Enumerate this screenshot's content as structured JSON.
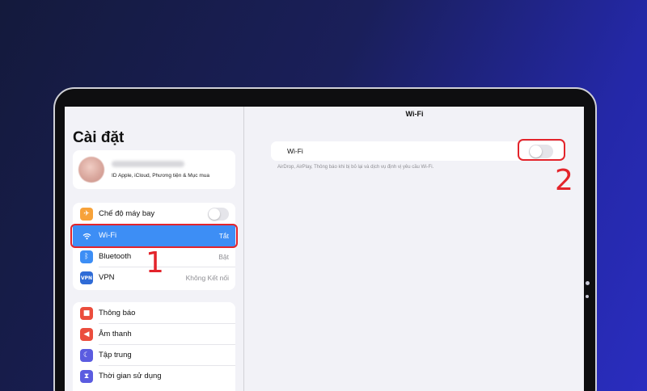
{
  "settings": {
    "title": "Cài đặt",
    "profile": {
      "subtitle": "ID Apple, iCloud, Phương tiện & Mục mua"
    },
    "group1": [
      {
        "label": "Chế độ máy bay",
        "value": "",
        "icon_color": "#f7a23a",
        "icon": "airplane-icon",
        "glyph": "✈"
      },
      {
        "label": "Wi-Fi",
        "value": "Tắt",
        "icon_color": "#3d8ef5",
        "icon": "wifi-icon",
        "glyph": "◠"
      },
      {
        "label": "Bluetooth",
        "value": "Bật",
        "icon_color": "#3d8ef5",
        "icon": "bluetooth-icon",
        "glyph": "ᛒ"
      },
      {
        "label": "VPN",
        "value": "Không Kết nối",
        "icon_color": "#2f6bd6",
        "icon": "vpn-icon",
        "glyph": "VPN"
      }
    ],
    "group2": [
      {
        "label": "Thông báo",
        "icon_color": "#eb4d3d",
        "icon": "notification-icon",
        "glyph": "■"
      },
      {
        "label": "Âm thanh",
        "icon_color": "#eb4d3d",
        "icon": "sound-icon",
        "glyph": "◀"
      },
      {
        "label": "Tập trung",
        "icon_color": "#5b5ce0",
        "icon": "focus-moon-icon",
        "glyph": "☾"
      },
      {
        "label": "Thời gian sử dụng",
        "icon_color": "#5b5ce0",
        "icon": "hourglass-icon",
        "glyph": "⧗"
      }
    ],
    "airplane_mode_on": false
  },
  "wifi_detail": {
    "title": "Wi-Fi",
    "toggle_label": "Wi-Fi",
    "toggle_on": false,
    "footnote": "AirDrop, AirPlay, Thông báo khi bị bỏ lại và dịch vụ định vị yêu cầu Wi-Fi."
  },
  "annotations": {
    "step1": "1",
    "step2": "2",
    "highlight_color": "#e3242b"
  }
}
